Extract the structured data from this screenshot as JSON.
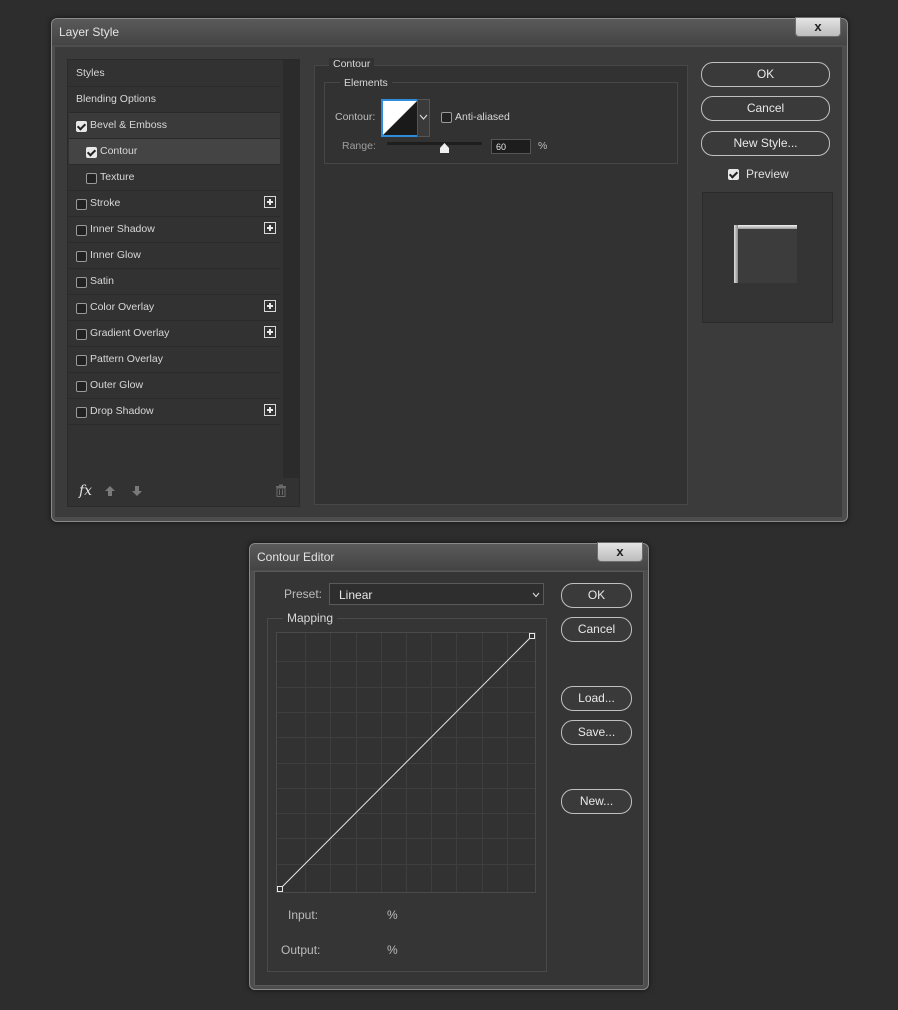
{
  "layer_style": {
    "title": "Layer Style",
    "close": "x",
    "styles": [
      {
        "label": "Styles",
        "checkbox": false,
        "checked": false,
        "indent": false,
        "plus": false,
        "active": false
      },
      {
        "label": "Blending Options",
        "checkbox": false,
        "checked": false,
        "indent": false,
        "plus": false,
        "active": false
      },
      {
        "label": "Bevel & Emboss",
        "checkbox": true,
        "checked": true,
        "indent": false,
        "plus": false,
        "active": false
      },
      {
        "label": "Contour",
        "checkbox": true,
        "checked": true,
        "indent": true,
        "plus": false,
        "active": true
      },
      {
        "label": "Texture",
        "checkbox": true,
        "checked": false,
        "indent": true,
        "plus": false,
        "active": false
      },
      {
        "label": "Stroke",
        "checkbox": true,
        "checked": false,
        "indent": false,
        "plus": true,
        "active": false
      },
      {
        "label": "Inner Shadow",
        "checkbox": true,
        "checked": false,
        "indent": false,
        "plus": true,
        "active": false
      },
      {
        "label": "Inner Glow",
        "checkbox": true,
        "checked": false,
        "indent": false,
        "plus": false,
        "active": false
      },
      {
        "label": "Satin",
        "checkbox": true,
        "checked": false,
        "indent": false,
        "plus": false,
        "active": false
      },
      {
        "label": "Color Overlay",
        "checkbox": true,
        "checked": false,
        "indent": false,
        "plus": true,
        "active": false
      },
      {
        "label": "Gradient Overlay",
        "checkbox": true,
        "checked": false,
        "indent": false,
        "plus": true,
        "active": false
      },
      {
        "label": "Pattern Overlay",
        "checkbox": true,
        "checked": false,
        "indent": false,
        "plus": false,
        "active": false
      },
      {
        "label": "Outer Glow",
        "checkbox": true,
        "checked": false,
        "indent": false,
        "plus": false,
        "active": false
      },
      {
        "label": "Drop Shadow",
        "checkbox": true,
        "checked": false,
        "indent": false,
        "plus": true,
        "active": false
      }
    ],
    "footer_fx": "fx",
    "contour_section": {
      "title": "Contour",
      "elements_label": "Elements",
      "contour_label": "Contour:",
      "anti_aliased_label": "Anti-aliased",
      "anti_aliased": false,
      "range_label": "Range:",
      "range_value": "60",
      "range_percent": 60,
      "range_unit": "%"
    },
    "buttons": {
      "ok": "OK",
      "cancel": "Cancel",
      "new_style": "New Style..."
    },
    "preview_label": "Preview",
    "preview_checked": true
  },
  "contour_editor": {
    "title": "Contour Editor",
    "close": "x",
    "preset_label": "Preset:",
    "preset_value": "Linear",
    "mapping_label": "Mapping",
    "input_label": "Input:",
    "input_unit": "%",
    "output_label": "Output:",
    "output_unit": "%",
    "buttons": {
      "ok": "OK",
      "cancel": "Cancel",
      "load": "Load...",
      "save": "Save...",
      "new": "New..."
    },
    "curve_points": [
      [
        0,
        0
      ],
      [
        100,
        100
      ]
    ]
  }
}
